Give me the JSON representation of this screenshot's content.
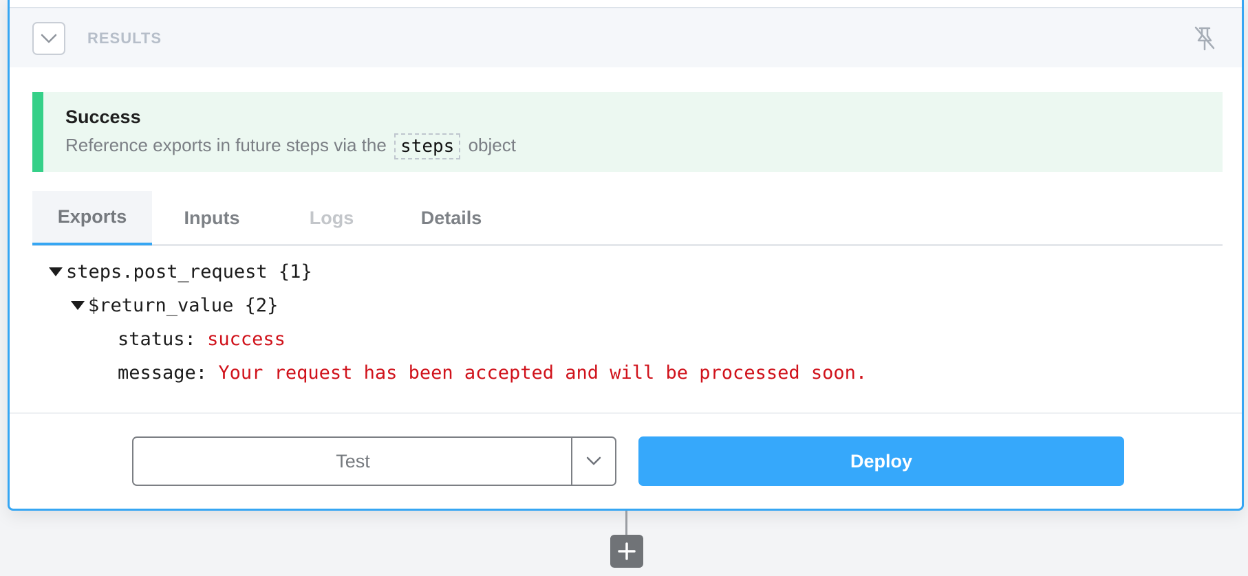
{
  "results_header": {
    "label": "RESULTS",
    "collapse_icon": "chevron-down-icon",
    "pin_icon": "unpin-icon"
  },
  "alert": {
    "title": "Success",
    "text_before": "Reference exports in future steps via the",
    "code": "steps",
    "text_after": "object",
    "accent_color": "#35d088"
  },
  "tabs": [
    {
      "label": "Exports",
      "state": "active"
    },
    {
      "label": "Inputs",
      "state": "normal"
    },
    {
      "label": "Logs",
      "state": "disabled"
    },
    {
      "label": "Details",
      "state": "normal"
    }
  ],
  "exports": {
    "root_key": "steps.post_request {1}",
    "child_key": "$return_value {2}",
    "fields": [
      {
        "key": "status:",
        "value": "success"
      },
      {
        "key": "message:",
        "value": "Your request has been accepted and will be processed soon."
      }
    ]
  },
  "footer": {
    "test_label": "Test",
    "deploy_label": "Deploy",
    "accent_color": "#36a8fb"
  },
  "add_step_icon": "plus-icon"
}
